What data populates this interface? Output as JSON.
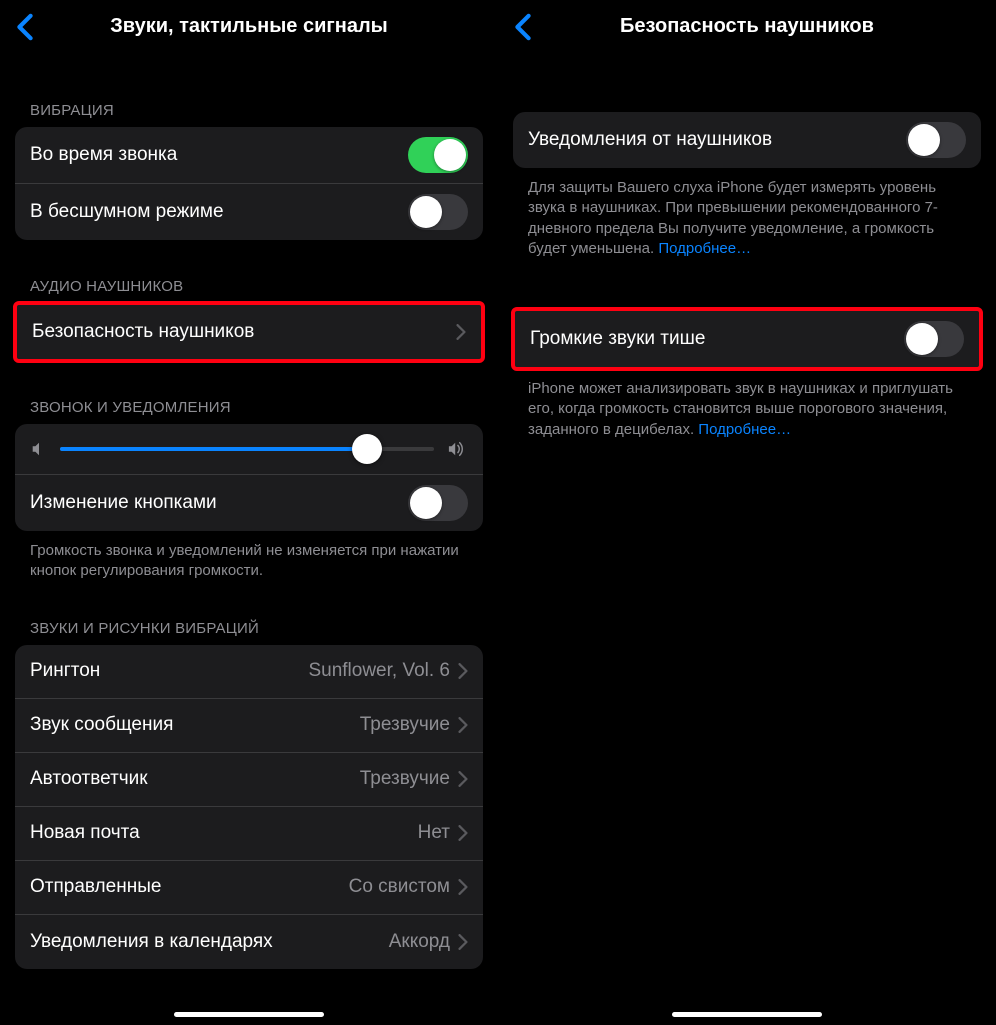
{
  "left": {
    "title": "Звуки, тактильные сигналы",
    "sections": {
      "vibration": {
        "header": "ВИБРАЦИЯ",
        "ring": {
          "label": "Во время звонка",
          "on": true
        },
        "silent": {
          "label": "В бесшумном режиме",
          "on": false
        }
      },
      "headphone_audio": {
        "header": "АУДИО НАУШНИКОВ",
        "safety": {
          "label": "Безопасность наушников"
        }
      },
      "ringer": {
        "header": "ЗВОНОК И УВЕДОМЛЕНИЯ",
        "slider_percent": 82,
        "change_with_buttons": {
          "label": "Изменение кнопками",
          "on": false
        },
        "footer": "Громкость звонка и уведомлений не изменяется при нажатии кнопок регулирования громкости."
      },
      "sounds": {
        "header": "ЗВУКИ И РИСУНКИ ВИБРАЦИЙ",
        "items": [
          {
            "label": "Рингтон",
            "value": "Sunflower, Vol. 6"
          },
          {
            "label": "Звук сообщения",
            "value": "Трезвучие"
          },
          {
            "label": "Автоответчик",
            "value": "Трезвучие"
          },
          {
            "label": "Новая почта",
            "value": "Нет"
          },
          {
            "label": "Отправленные",
            "value": "Со свистом"
          },
          {
            "label": "Уведомления в календарях",
            "value": "Аккорд"
          }
        ]
      }
    }
  },
  "right": {
    "title": "Безопасность наушников",
    "notifications": {
      "label": "Уведомления от наушников",
      "on": false,
      "footer": "Для защиты Вашего слуха iPhone будет измерять уровень звука в наушниках. При превышении рекомендованного 7-дневного предела Вы получите уведомление, а громкость будет уменьшена. ",
      "link": "Подробнее…"
    },
    "reduce_loud": {
      "label": "Громкие звуки тише",
      "on": false,
      "footer": "iPhone может анализировать звук в наушниках и приглушать его, когда громкость становится выше порогового значения, заданного в децибелах. ",
      "link": "Подробнее…"
    }
  }
}
